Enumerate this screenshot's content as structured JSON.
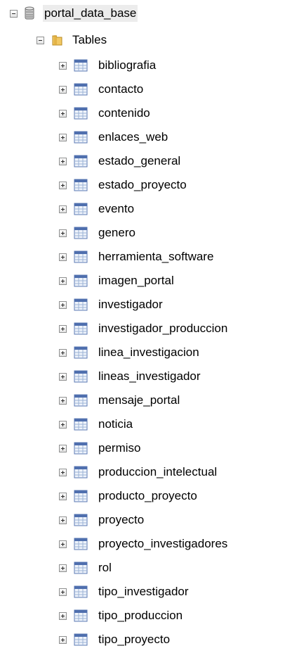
{
  "database": {
    "name": "portal_data_base",
    "expanded": true,
    "icon": "database-icon"
  },
  "folder": {
    "name": "Tables",
    "expanded": true,
    "icon": "folder-icon"
  },
  "tables": [
    "bibliografia",
    "contacto",
    "contenido",
    "enlaces_web",
    "estado_general",
    "estado_proyecto",
    "evento",
    "genero",
    "herramienta_software",
    "imagen_portal",
    "investigador",
    "investigador_produccion",
    "linea_investigacion",
    "lineas_investigador",
    "mensaje_portal",
    "noticia",
    "permiso",
    "produccion_intelectual",
    "producto_proyecto",
    "proyecto",
    "proyecto_investigadores",
    "rol",
    "tipo_investigador",
    "tipo_produccion",
    "tipo_proyecto"
  ],
  "table_icon": "table-icon",
  "colors": {
    "expander_border": "#8e8f8f",
    "table_icon_header": "#4f6fae",
    "table_icon_grid": "#9cb3d6",
    "folder": "#e8b84a",
    "database": "#8a8a8a"
  }
}
